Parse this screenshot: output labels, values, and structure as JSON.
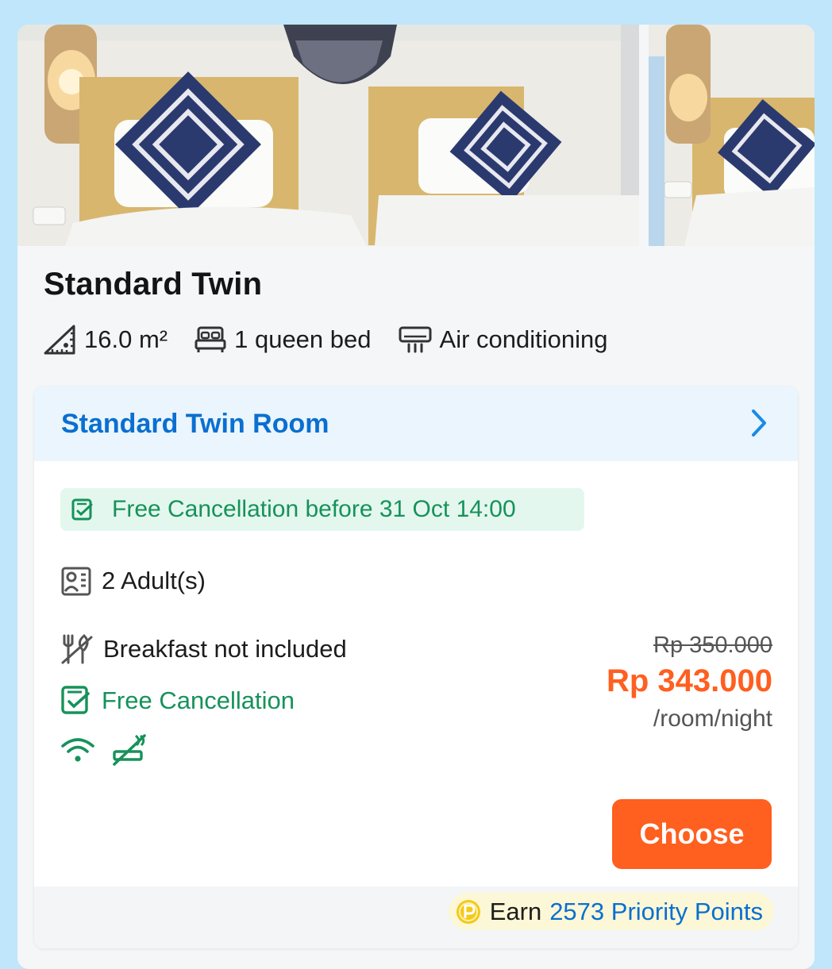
{
  "room": {
    "name": "Standard Twin",
    "features": [
      {
        "icon": "room-size-icon",
        "label": "16.0 m²"
      },
      {
        "icon": "bed-icon",
        "label": "1 queen bed"
      },
      {
        "icon": "air-conditioner-icon",
        "label": "Air conditioning"
      }
    ]
  },
  "offer": {
    "name": "Standard Twin Room",
    "cancellation_badge": "Free Cancellation before 31 Oct 14:00",
    "occupancy": "2 Adult(s)",
    "breakfast": "Breakfast not included",
    "cancellation": "Free Cancellation",
    "amenities": [
      "wifi-icon",
      "no-smoking-icon"
    ],
    "original_price": "Rp 350.000",
    "price": "Rp 343.000",
    "price_unit": "/room/night",
    "choose_label": "Choose",
    "points_earn_label": "Earn",
    "points_value": "2573 Priority Points"
  },
  "colors": {
    "accent_blue": "#0a6fd0",
    "price_orange": "#ff5f1f",
    "success_green": "#16925a",
    "background": "#bfe6fb"
  }
}
